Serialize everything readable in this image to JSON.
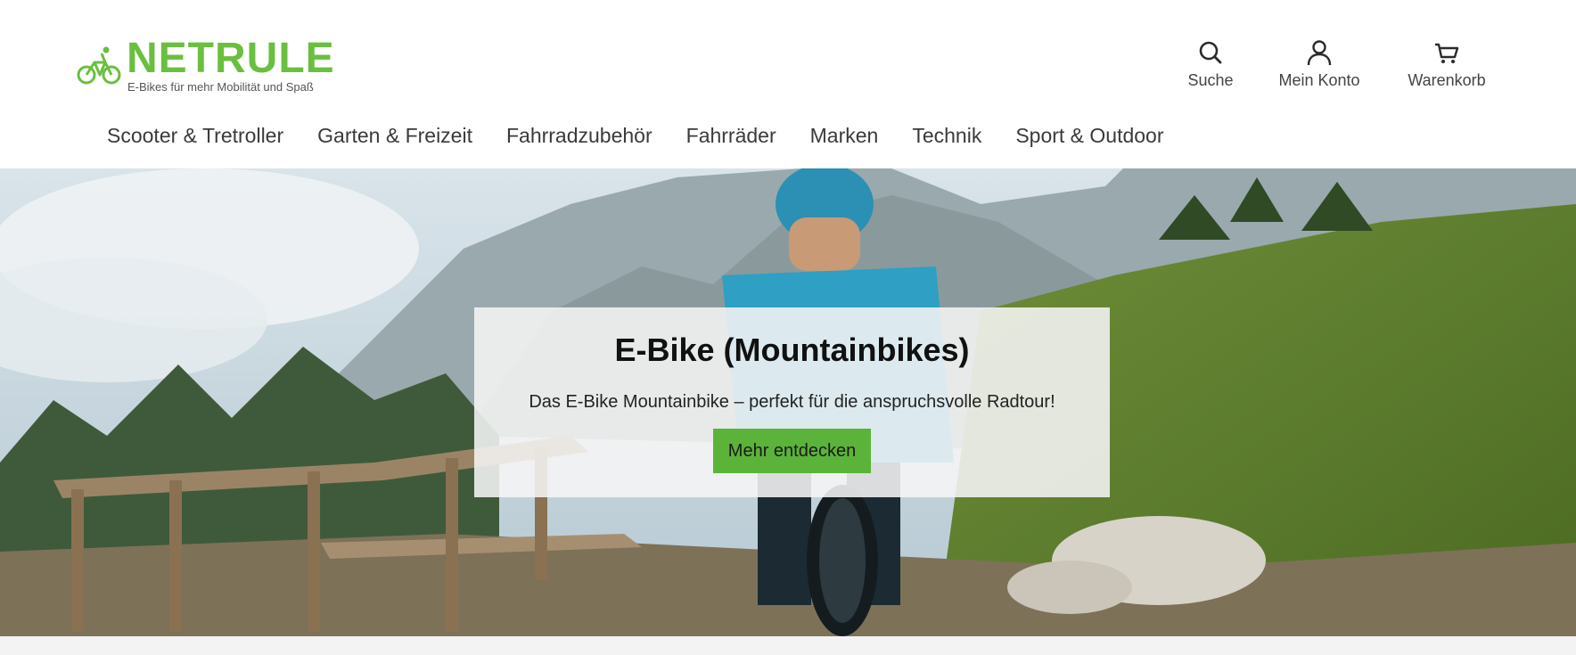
{
  "brand": {
    "name": "NETRULE",
    "tagline": "E-Bikes für mehr Mobilität und Spaß",
    "color": "#6abf3f"
  },
  "header_actions": [
    {
      "label": "Suche",
      "icon": "search-icon"
    },
    {
      "label": "Mein Konto",
      "icon": "user-icon"
    },
    {
      "label": "Warenkorb",
      "icon": "cart-icon"
    }
  ],
  "nav": {
    "items": [
      "Scooter & Tretroller",
      "Garten & Freizeit",
      "Fahrradzubehör",
      "Fahrräder",
      "Marken",
      "Technik",
      "Sport & Outdoor"
    ]
  },
  "hero": {
    "title": "E-Bike (Mountainbikes)",
    "subtitle": "Das E-Bike Mountainbike – perfekt für die anspruchsvolle Radtour!",
    "button_label": "Mehr entdecken",
    "button_color": "#5cb33a",
    "image": "mountain-biker-photo"
  }
}
